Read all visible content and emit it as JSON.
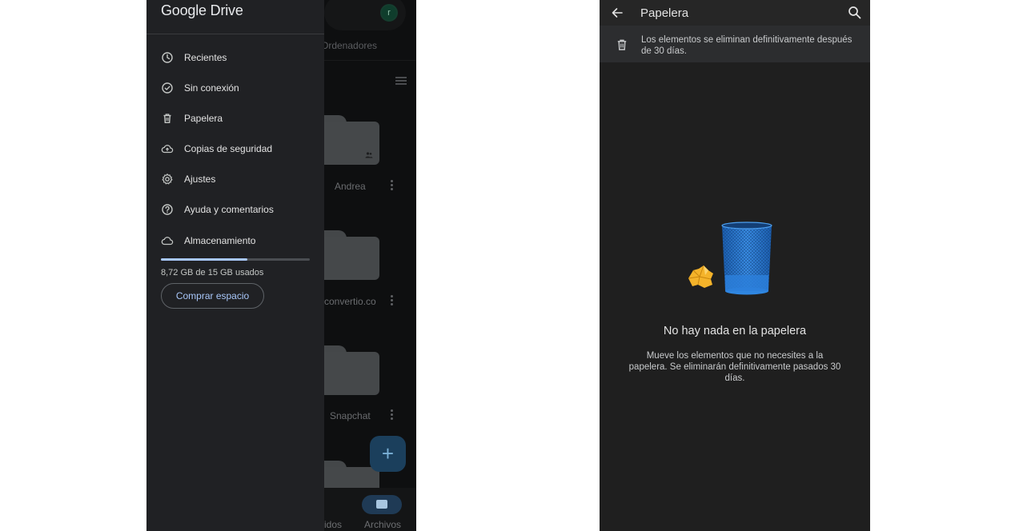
{
  "left_screen": {
    "app_title": "Google Drive",
    "avatar_initial": "r",
    "background": {
      "tab_label": "Ordenadores",
      "folders": [
        {
          "name": "Andrea",
          "shared": true
        },
        {
          "name": "convertio.co",
          "shared": false
        },
        {
          "name": "Snapchat",
          "shared": false
        }
      ],
      "fab_label": "+",
      "bottom_nav": {
        "partial_label": "idos",
        "active_label": "Archivos"
      }
    },
    "drawer": {
      "items": [
        {
          "label": "Recientes",
          "icon": "clock-icon"
        },
        {
          "label": "Sin conexión",
          "icon": "offline-check-icon"
        },
        {
          "label": "Papelera",
          "icon": "trash-icon"
        },
        {
          "label": "Copias de seguridad",
          "icon": "cloud-upload-icon"
        },
        {
          "label": "Ajustes",
          "icon": "gear-icon"
        },
        {
          "label": "Ayuda y comentarios",
          "icon": "help-icon"
        },
        {
          "label": "Almacenamiento",
          "icon": "cloud-icon"
        }
      ],
      "storage": {
        "used_fraction": 0.58,
        "text": "8,72 GB de 15 GB usados",
        "bar_color": "#a8c7fa"
      },
      "buy_button": "Comprar espacio"
    }
  },
  "right_screen": {
    "title": "Papelera",
    "banner_text": "Los elementos se eliminan definitivamente después de 30 días.",
    "empty_title": "No hay nada en la papelera",
    "empty_description": "Mueve los elementos que no necesites a la papelera. Se eliminarán definitivamente pasados 30 días.",
    "accent_color": "#2a7bd6"
  }
}
